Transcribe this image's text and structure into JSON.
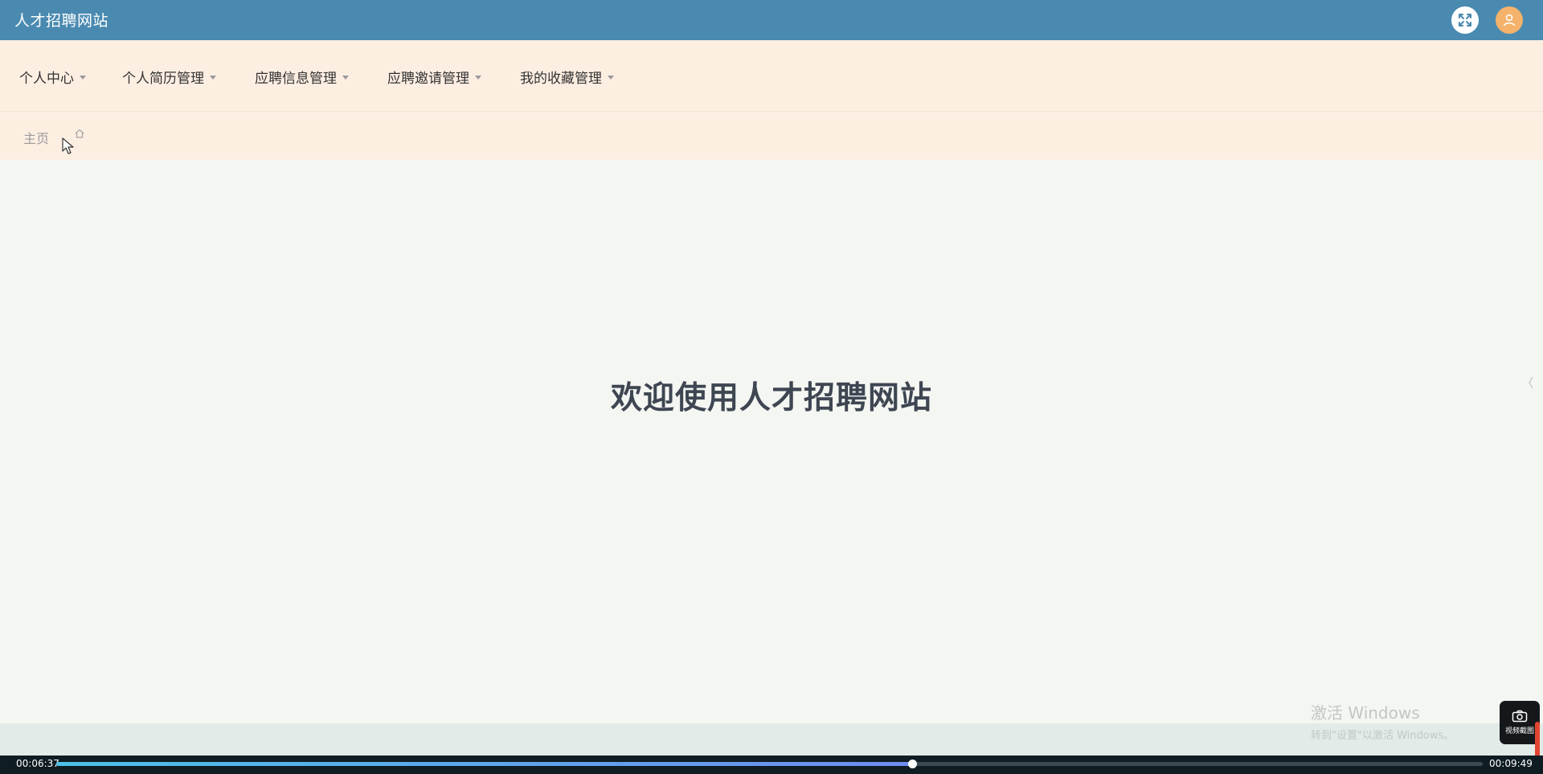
{
  "header": {
    "site_title": "人才招聘网站",
    "fullscreen_icon": "fullscreen-icon",
    "avatar_icon": "user-avatar-icon",
    "colors": {
      "bar": "#4a8ab0",
      "avatar": "#f4b26b"
    }
  },
  "nav": {
    "items": [
      {
        "label": "个人中心"
      },
      {
        "label": "个人简历管理"
      },
      {
        "label": "应聘信息管理"
      },
      {
        "label": "应聘邀请管理"
      },
      {
        "label": "我的收藏管理"
      }
    ],
    "background": "#fdeee2"
  },
  "breadcrumb": {
    "home_label": "主页",
    "home_icon": "home-icon"
  },
  "main": {
    "welcome_text": "欢迎使用人才招聘网站"
  },
  "watermark": {
    "title": "激活 Windows",
    "subtitle": "转到\"设置\"以激活 Windows。"
  },
  "player": {
    "current_time": "00:06:37",
    "total_time": "00:09:49",
    "progress": 0.6,
    "screenshot_label": "视频截图",
    "screenshot_icon": "camera-icon"
  }
}
